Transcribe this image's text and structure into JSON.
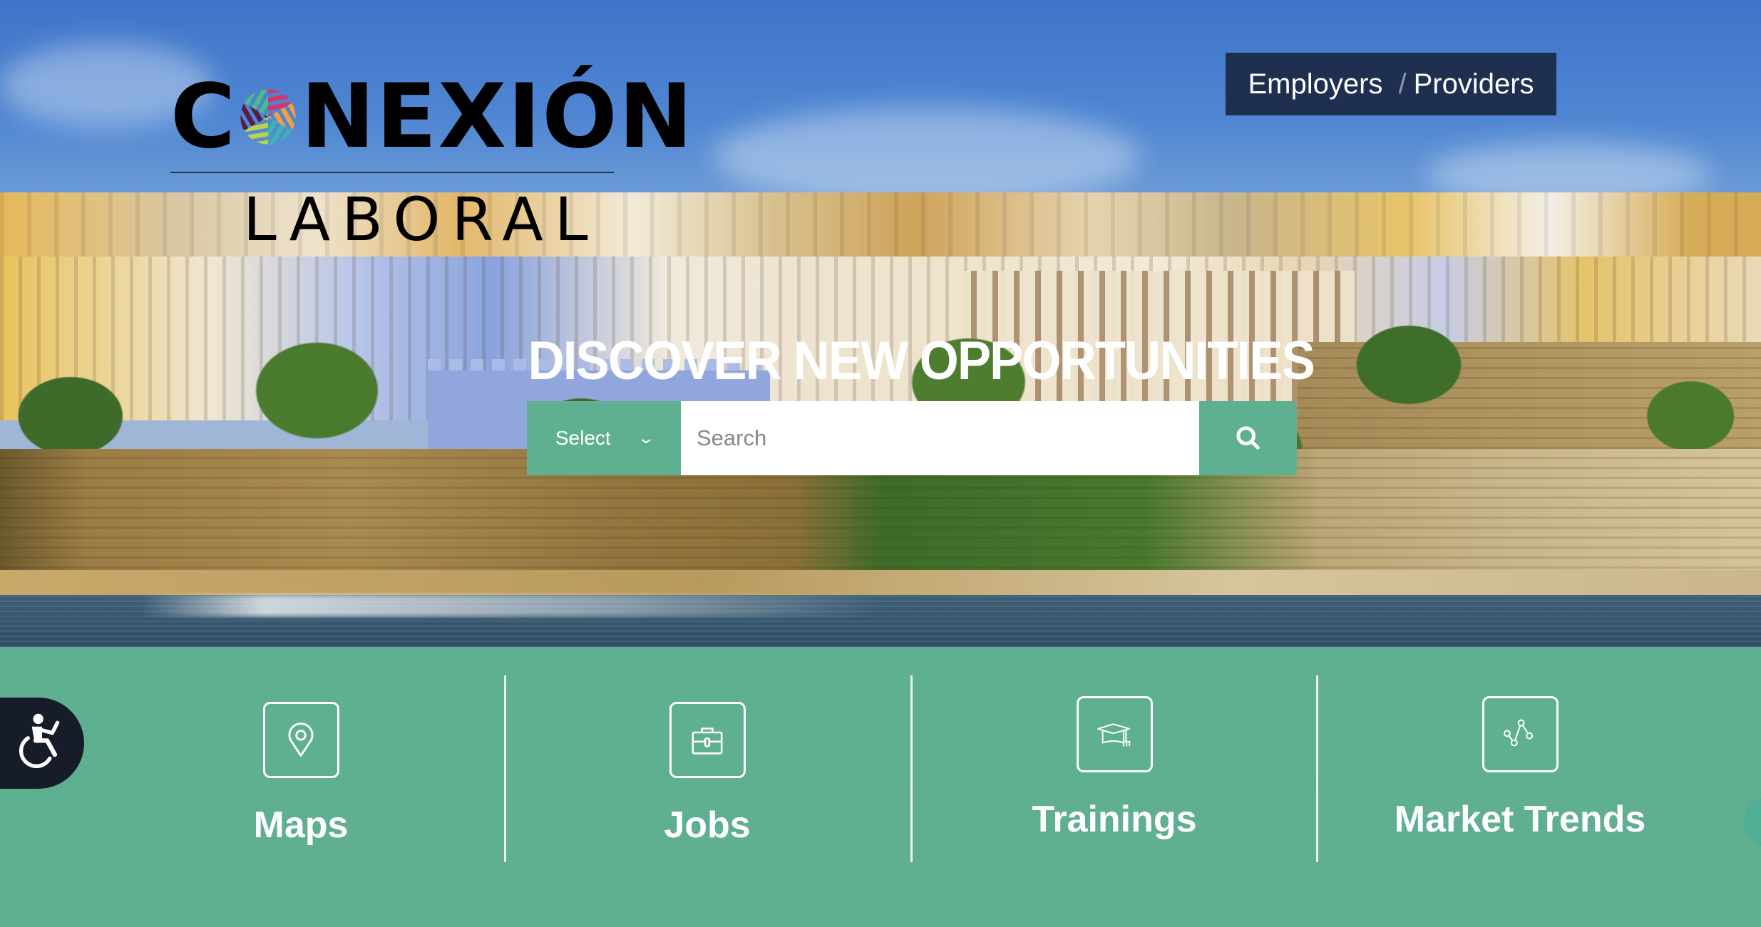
{
  "brand": {
    "name_top": "C",
    "name_rest": "NEXIÓN",
    "name_sub": "LABORAL",
    "logo_mark_colors": [
      "#d6336c",
      "#f0a040",
      "#3ab5b0",
      "#b8d44a",
      "#5a1a4a",
      "#4cba8a"
    ]
  },
  "audience_nav": {
    "employers": "Employers",
    "separator": "/",
    "providers": "Providers"
  },
  "hero": {
    "headline": "DISCOVER NEW OPPORTUNITIES"
  },
  "search": {
    "select_label": "Select",
    "select_icon": "chevron-down-icon",
    "input_value": "",
    "input_placeholder": "Search",
    "button_icon": "search-icon"
  },
  "features": [
    {
      "label": "Maps",
      "icon": "map-pin-icon"
    },
    {
      "label": "Jobs",
      "icon": "briefcase-icon"
    },
    {
      "label": "Trainings",
      "icon": "graduation-cap-icon"
    },
    {
      "label": "Market Trends",
      "icon": "line-chart-icon"
    }
  ],
  "widgets": {
    "accessibility_icon": "accessibility-icon",
    "chat_icon": "chat-widget-icon"
  },
  "colors": {
    "accent_green": "#5eb090",
    "nav_bg": "#1f2f50",
    "accessibility_bg": "#171c2a"
  }
}
